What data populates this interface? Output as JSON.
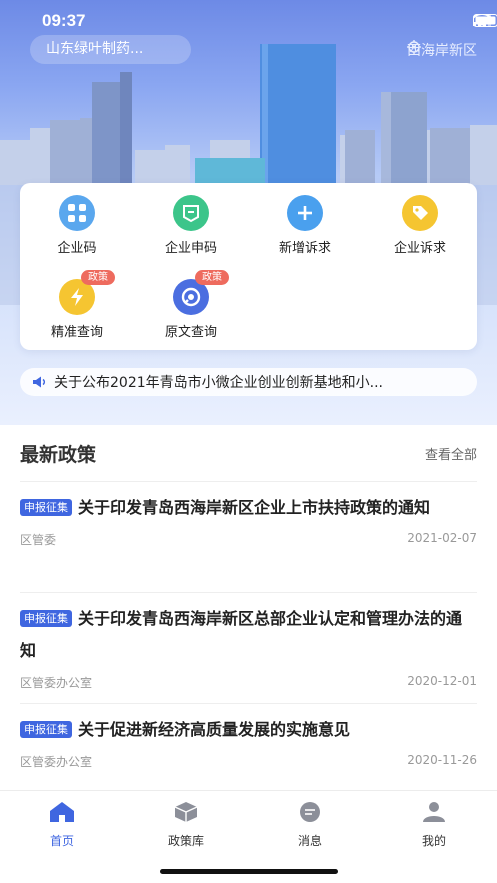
{
  "status": {
    "time": "09:37"
  },
  "header": {
    "company": "山东绿叶制药...",
    "location": "西海岸新区"
  },
  "quick_actions": [
    {
      "label": "企业码",
      "icon": "qr-grid-icon",
      "color": "#5aa7ee",
      "badge": ""
    },
    {
      "label": "企业申码",
      "icon": "document-apply-icon",
      "color": "#3cc58a",
      "badge": ""
    },
    {
      "label": "新增诉求",
      "icon": "plus-icon",
      "color": "#4aa0ee",
      "badge": ""
    },
    {
      "label": "企业诉求",
      "icon": "tag-icon",
      "color": "#f5c531",
      "badge": ""
    },
    {
      "label": "精准查询",
      "icon": "lightning-icon",
      "color": "#f5c531",
      "badge": "政策"
    },
    {
      "label": "原文查询",
      "icon": "circle-eye-icon",
      "color": "#4b6ee0",
      "badge": "政策"
    }
  ],
  "notice": {
    "text": "关于公布2021年青岛市小微企业创业创新基地和小..."
  },
  "policies": {
    "title": "最新政策",
    "more": "查看全部",
    "items": [
      {
        "tag": "申报征集",
        "title": "关于印发青岛西海岸新区企业上市扶持政策的通知",
        "source": "区管委",
        "date": "2021-02-07"
      },
      {
        "tag": "申报征集",
        "title": "关于印发青岛西海岸新区总部企业认定和管理办法的通知",
        "source": "区管委办公室",
        "date": "2020-12-01"
      },
      {
        "tag": "申报征集",
        "title": "关于促进新经济高质量发展的实施意见",
        "source": "区管委办公室",
        "date": "2020-11-26"
      }
    ]
  },
  "tabbar": [
    {
      "label": "首页",
      "active": true
    },
    {
      "label": "政策库",
      "active": false
    },
    {
      "label": "消息",
      "active": false
    },
    {
      "label": "我的",
      "active": false
    }
  ],
  "colors": {
    "accent": "#3f66e0",
    "badge": "#ee6b5e"
  }
}
